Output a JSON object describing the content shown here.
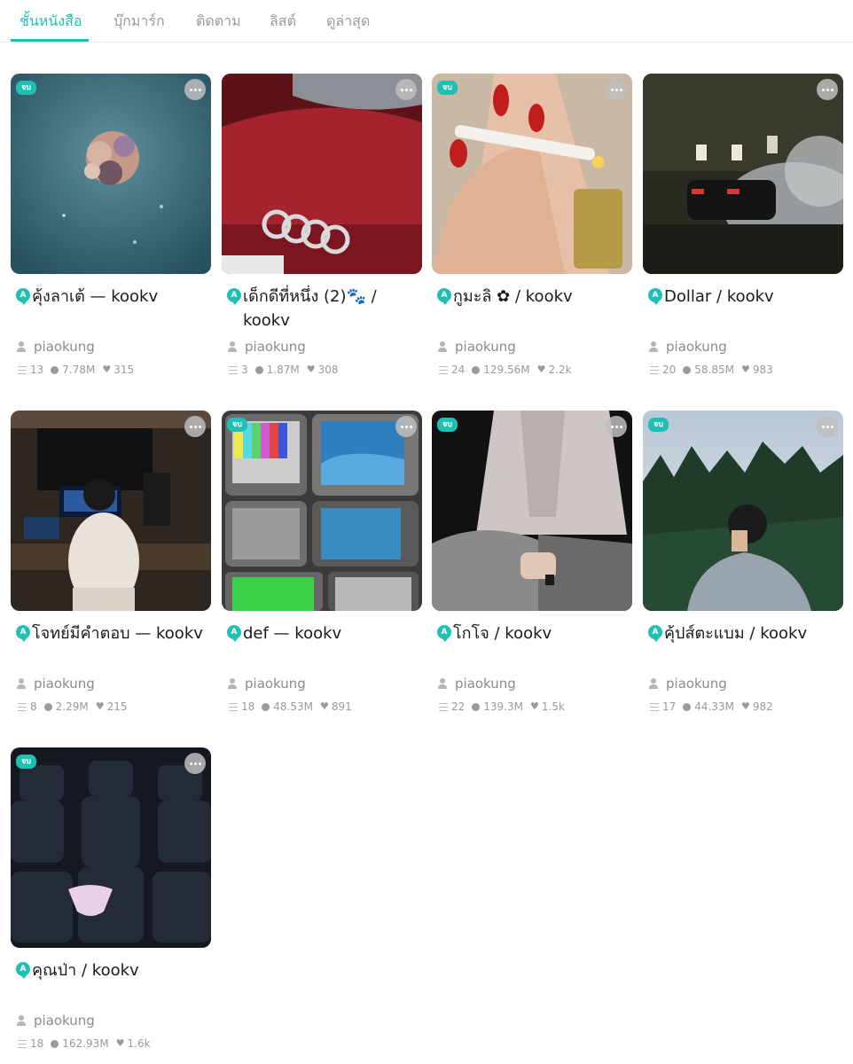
{
  "tabs": [
    {
      "label": "ชั้นหนังสือ",
      "active": true
    },
    {
      "label": "บุ๊กมาร์ก",
      "active": false
    },
    {
      "label": "ติดตาม",
      "active": false
    },
    {
      "label": "ลิสต์",
      "active": false
    },
    {
      "label": "ดูล่าสุด",
      "active": false
    }
  ],
  "accent_color": "#1ec0b4",
  "title_icon_letter": "A",
  "books": [
    {
      "title": "คุ้งลาเต้ — kookv",
      "author": "piaokung",
      "chapters": "13",
      "views": "7.78M",
      "likes": "315",
      "badge": "จบ",
      "cover": "flowers-water"
    },
    {
      "title": "เด็กดีที่หนึ่ง (2)🐾 / kookv",
      "author": "piaokung",
      "chapters": "3",
      "views": "1.87M",
      "likes": "308",
      "badge": "",
      "cover": "red-car"
    },
    {
      "title": "กูมะลิ ✿ / kookv",
      "author": "piaokung",
      "chapters": "24",
      "views": "129.56M",
      "likes": "2.2k",
      "badge": "จบ",
      "cover": "cigarette-hand"
    },
    {
      "title": "Dollar / kookv",
      "author": "piaokung",
      "chapters": "20",
      "views": "58.85M",
      "likes": "983",
      "badge": "",
      "cover": "car-smoke-night"
    },
    {
      "title": "โจทย์มีคำตอบ — kookv",
      "author": "piaokung",
      "chapters": "8",
      "views": "2.29M",
      "likes": "215",
      "badge": "",
      "cover": "studio"
    },
    {
      "title": "def — kookv",
      "author": "piaokung",
      "chapters": "18",
      "views": "48.53M",
      "likes": "891",
      "badge": "จบ",
      "cover": "tvs"
    },
    {
      "title": "โกโจ / kookv",
      "author": "piaokung",
      "chapters": "22",
      "views": "139.3M",
      "likes": "1.5k",
      "badge": "จบ",
      "cover": "sitting-man"
    },
    {
      "title": "คุ้ปส์ตะแบม / kookv",
      "author": "piaokung",
      "chapters": "17",
      "views": "44.33M",
      "likes": "982",
      "badge": "จบ",
      "cover": "forest-man"
    },
    {
      "title": "คุณป่า / kookv",
      "author": "piaokung",
      "chapters": "18",
      "views": "162.93M",
      "likes": "1.6k",
      "badge": "จบ",
      "cover": "cinema-seats"
    }
  ]
}
